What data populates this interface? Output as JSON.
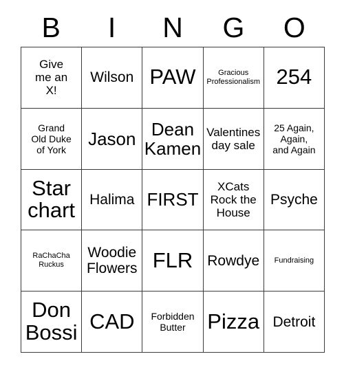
{
  "card": {
    "header_letters": [
      "B",
      "I",
      "N",
      "G",
      "O"
    ],
    "grid": {
      "rows": 5,
      "columns": 5,
      "border_color": "#3a3a3a",
      "background_color": "#ffffff",
      "text_color": "#000000"
    },
    "cells": [
      [
        {
          "text": "Give\nme an\nX!",
          "size": "md"
        },
        {
          "text": "Wilson",
          "size": "lg"
        },
        {
          "text": "PAW",
          "size": "xxl"
        },
        {
          "text": "Gracious\nProfessionalism",
          "size": "xs"
        },
        {
          "text": "254",
          "size": "xxl"
        }
      ],
      [
        {
          "text": "Grand\nOld Duke\nof York",
          "size": "sm"
        },
        {
          "text": "Jason",
          "size": "xl"
        },
        {
          "text": "Dean\nKamen",
          "size": "xl"
        },
        {
          "text": "Valentines\nday sale",
          "size": "md"
        },
        {
          "text": "25 Again,\nAgain,\nand Again",
          "size": "sm"
        }
      ],
      [
        {
          "text": "Star\nchart",
          "size": "xxl"
        },
        {
          "text": "Halima",
          "size": "lg"
        },
        {
          "text": "FIRST",
          "size": "xl"
        },
        {
          "text": "XCats\nRock the\nHouse",
          "size": "md"
        },
        {
          "text": "Psyche",
          "size": "lg"
        }
      ],
      [
        {
          "text": "RaChaCha\nRuckus",
          "size": "xs"
        },
        {
          "text": "Woodie\nFlowers",
          "size": "lg"
        },
        {
          "text": "FLR",
          "size": "xxl"
        },
        {
          "text": "Rowdye",
          "size": "lg"
        },
        {
          "text": "Fundraising",
          "size": "xs"
        }
      ],
      [
        {
          "text": "Don\nBossi",
          "size": "xxl"
        },
        {
          "text": "CAD",
          "size": "xxl"
        },
        {
          "text": "Forbidden\nButter",
          "size": "sm"
        },
        {
          "text": "Pizza",
          "size": "xxl"
        },
        {
          "text": "Detroit",
          "size": "lg"
        }
      ]
    ]
  }
}
